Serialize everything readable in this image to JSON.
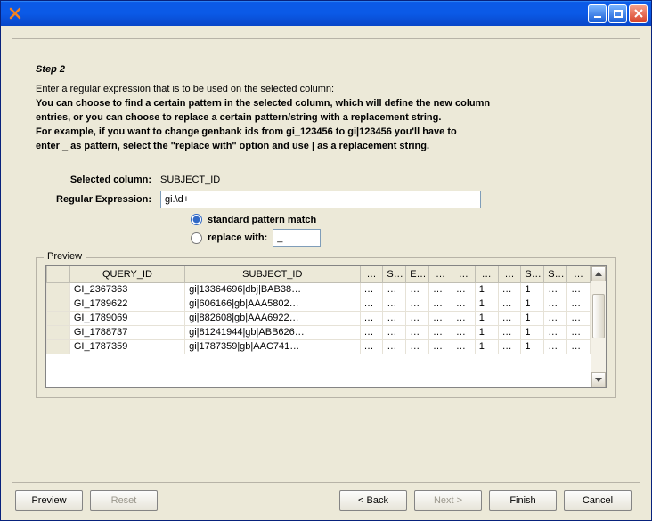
{
  "window": {
    "title": ""
  },
  "step": {
    "title": "Step 2",
    "instruction": "Enter a regular expression that is to be used on the selected column:",
    "bold1": "You can choose to find a certain pattern in the selected column, which will define the new column",
    "bold2": "entries, or you can choose to replace a certain pattern/string with a replacement string.",
    "bold3": "For example, if you want to change genbank ids from gi_123456 to gi|123456 you'll have to",
    "bold4": "enter _ as pattern, select the \"replace with\" option and use | as a replacement string."
  },
  "form": {
    "selected_column_label": "Selected column:",
    "selected_column_value": "SUBJECT_ID",
    "regex_label": "Regular Expression:",
    "regex_value": "gi.\\d+",
    "radio_standard": "standard pattern match",
    "radio_replace": "replace with:",
    "replace_value": "_"
  },
  "preview": {
    "legend": "Preview",
    "cols": [
      "QUERY_ID",
      "SUBJECT_ID",
      "…",
      "S…",
      "E…",
      "…",
      "…",
      "…",
      "…",
      "S…",
      "S…",
      "…"
    ],
    "rows": [
      [
        "GI_2367363",
        "gi|13364696|dbj|BAB38…",
        "…",
        "…",
        "…",
        "…",
        "…",
        "1",
        "…",
        "1",
        "…",
        "…"
      ],
      [
        "GI_1789622",
        "gi|606166|gb|AAA5802…",
        "…",
        "…",
        "…",
        "…",
        "…",
        "1",
        "…",
        "1",
        "…",
        "…"
      ],
      [
        "GI_1789069",
        "gi|882608|gb|AAA6922…",
        "…",
        "…",
        "…",
        "…",
        "…",
        "1",
        "…",
        "1",
        "…",
        "…"
      ],
      [
        "GI_1788737",
        "gi|81241944|gb|ABB626…",
        "…",
        "…",
        "…",
        "…",
        "…",
        "1",
        "…",
        "1",
        "…",
        "…"
      ],
      [
        "GI_1787359",
        "gi|1787359|gb|AAC741…",
        "…",
        "…",
        "…",
        "…",
        "…",
        "1",
        "…",
        "1",
        "…",
        "…"
      ]
    ]
  },
  "buttons": {
    "preview": "Preview",
    "reset": "Reset",
    "back": "< Back",
    "next": "Next >",
    "finish": "Finish",
    "cancel": "Cancel"
  }
}
